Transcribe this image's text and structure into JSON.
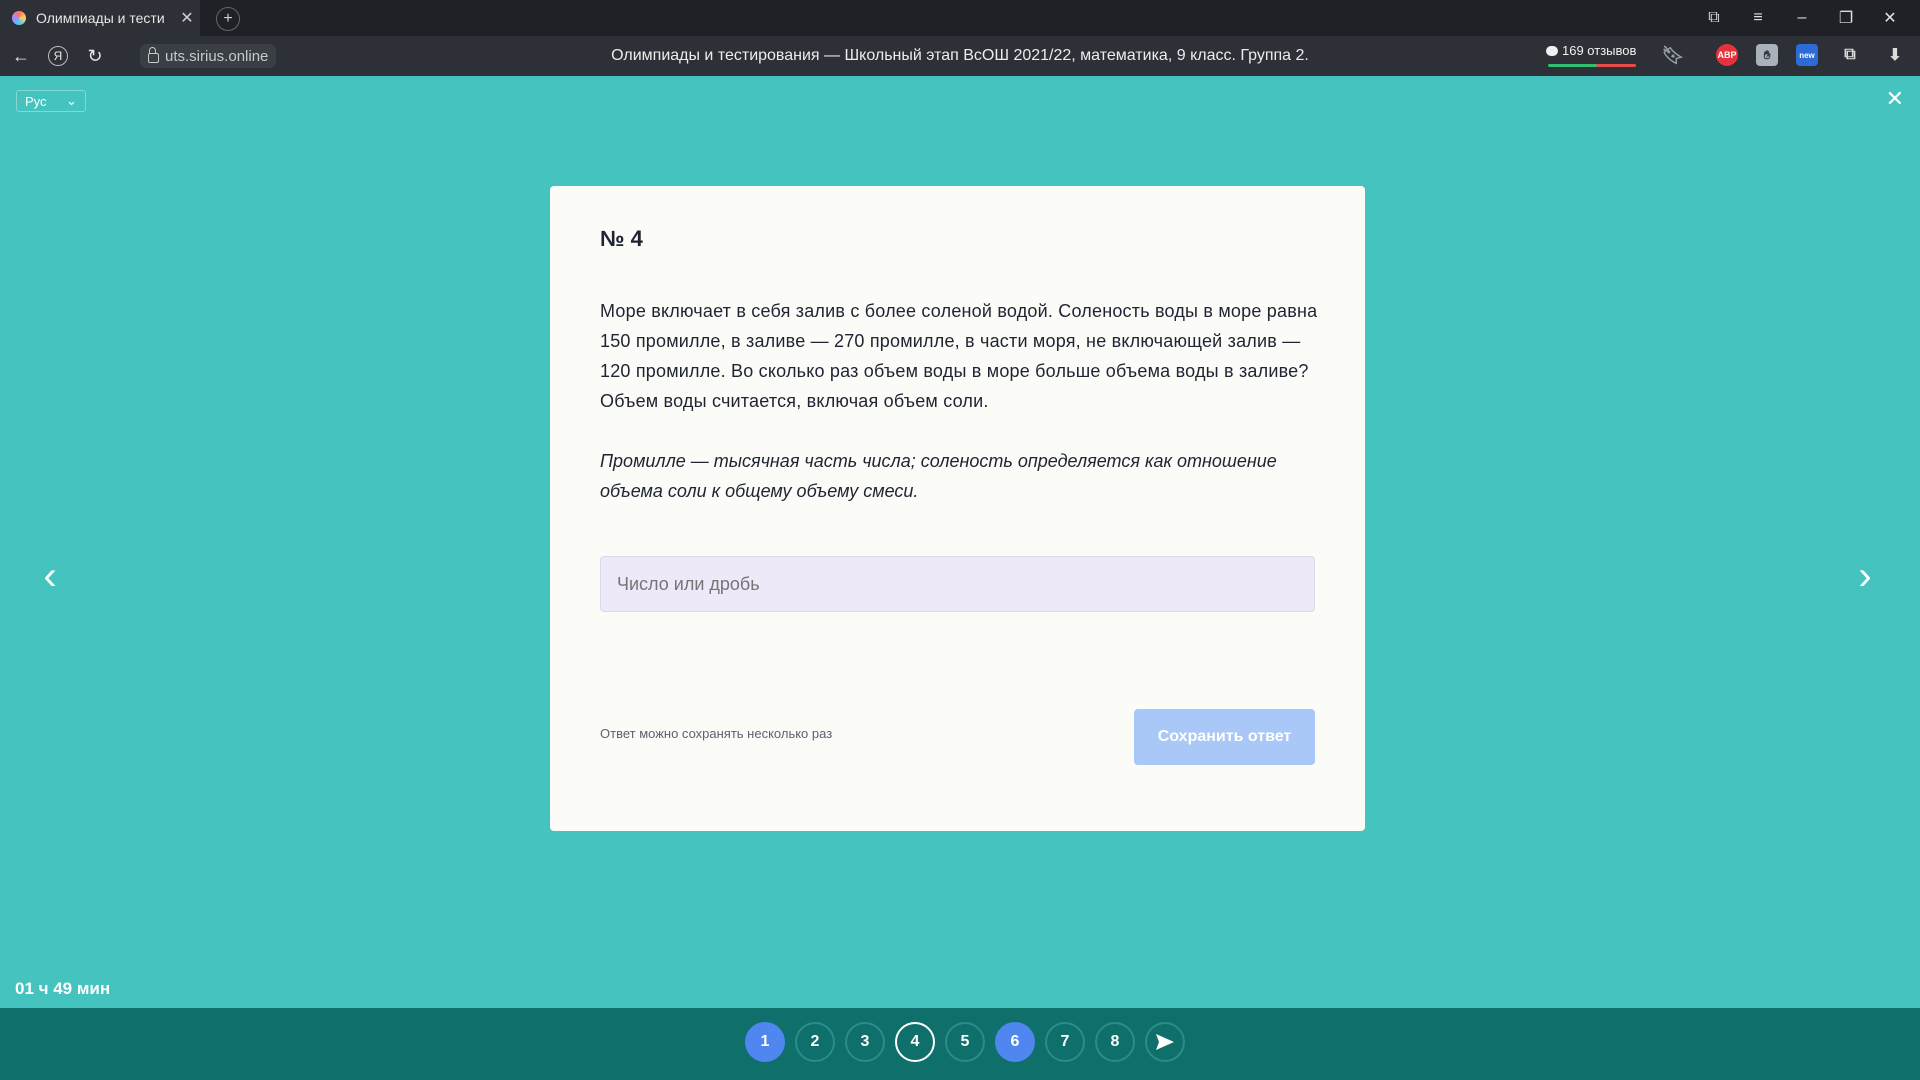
{
  "browser": {
    "tab_title": "Олимпиады и тестиров",
    "tab_close_icon": "close-icon",
    "new_tab_icon": "plus-icon",
    "url": "uts.sirius.online",
    "page_title": "Олимпиады и тестирования — Школьный этап ВсОШ 2021/22, математика, 9 класс. Группа 2.",
    "reviews": "169 отзывов",
    "ext_abp": "ABP",
    "ext_new": "new"
  },
  "page": {
    "lang": "Рус",
    "question_number": "№ 4",
    "question_text": "Море включает в себя залив с более соленой водой. Соленость воды в море равна 150 промилле, в заливе — 270 промилле, в части моря, не включающей залив — 120 промилле. Во сколько раз объем воды в море больше объема воды в заливе? Объем воды считается, включая объем соли.",
    "note_text": "Промилле — тысячная часть числа; соленость определяется как отношение объема соли к общему объему смеси.",
    "answer_placeholder": "Число или дробь",
    "hint": "Ответ можно сохранять несколько раз",
    "save_label": "Сохранить ответ",
    "timer": "01 ч 49 мин"
  },
  "pager": [
    "1",
    "2",
    "3",
    "4",
    "5",
    "6",
    "7",
    "8"
  ],
  "colors": {
    "background": "#44c3bf",
    "bottom_bar": "#0f6f6b",
    "answered": "#4f86f0",
    "save_button": "#a9c8f7"
  }
}
